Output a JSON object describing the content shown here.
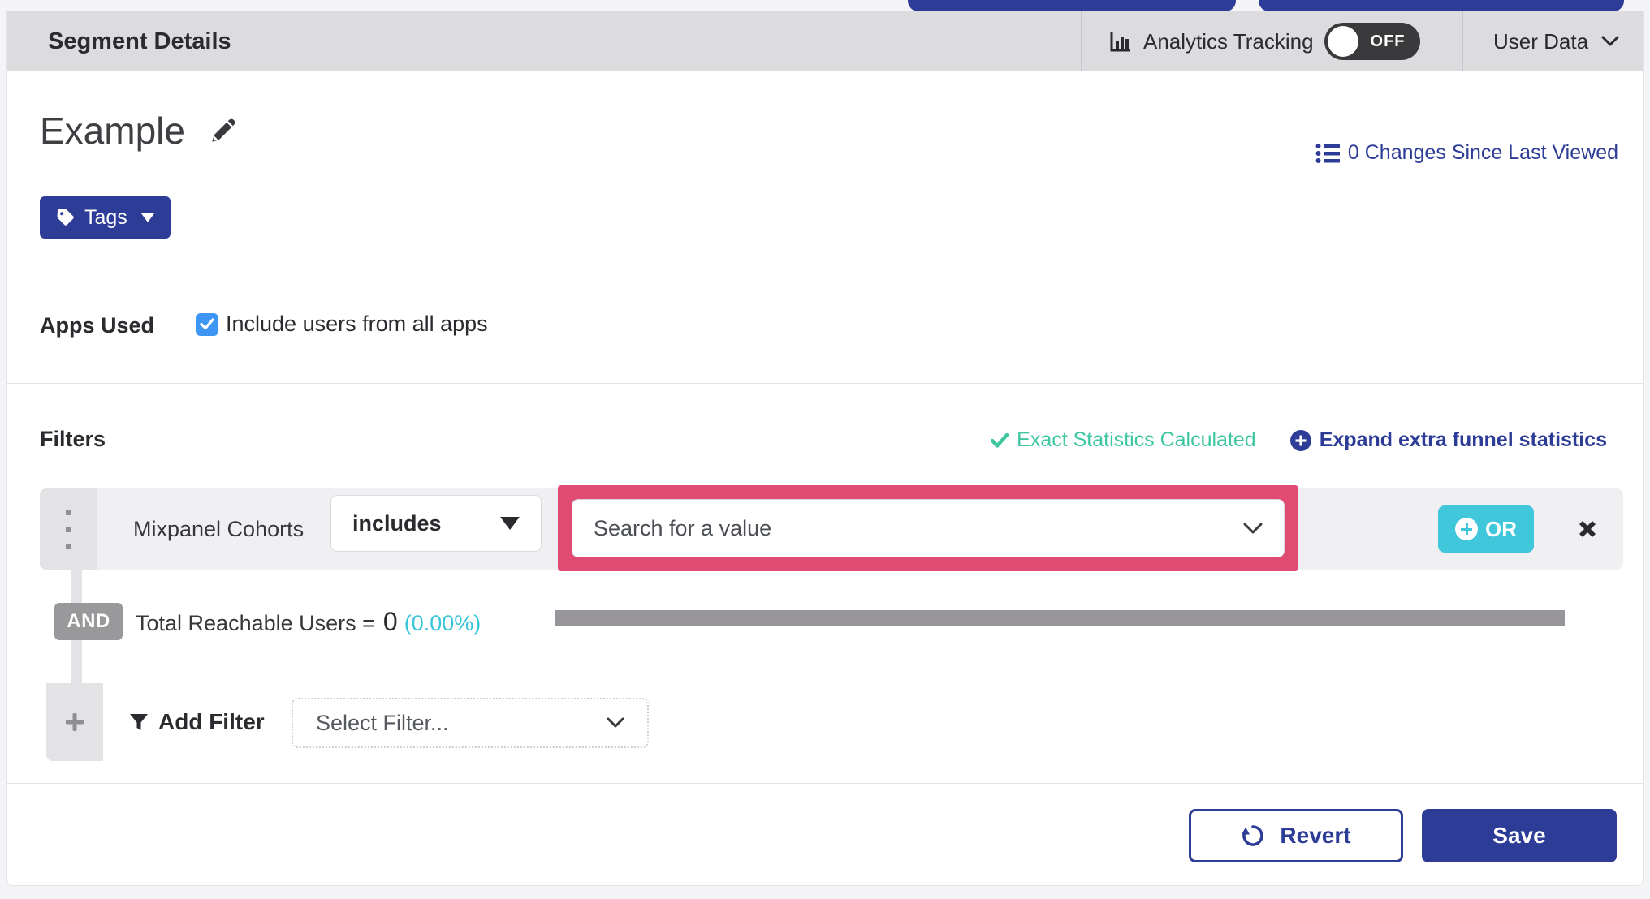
{
  "header": {
    "title": "Segment Details",
    "analytics_label": "Analytics Tracking",
    "toggle_state": "OFF",
    "user_data_label": "User Data"
  },
  "segment": {
    "name": "Example",
    "tags_label": "Tags",
    "changes_link": "0 Changes Since Last Viewed"
  },
  "apps": {
    "label": "Apps Used",
    "checkbox_label": "Include users from all apps",
    "checkbox_checked": true
  },
  "filters": {
    "heading": "Filters",
    "exact_stats": "Exact Statistics Calculated",
    "expand_link": "Expand extra funnel statistics",
    "row": {
      "name": "Mixpanel Cohorts",
      "operator": "includes",
      "value_placeholder": "Search for a value",
      "or_label": "OR"
    },
    "and_label": "AND",
    "total": {
      "label": "Total Reachable Users =",
      "value": "0",
      "percent": "(0.00%)",
      "bar_fill_percent": 0
    },
    "add": {
      "label": "Add Filter",
      "placeholder": "Select Filter..."
    }
  },
  "footer": {
    "revert_label": "Revert",
    "save_label": "Save"
  },
  "colors": {
    "indigo": "#2d3c96",
    "success_teal": "#3fc7a2",
    "stat_cyan": "#38c5d8",
    "or_button_cyan": "#41c7dc",
    "highlight_pink": "#e14b72",
    "checkbox_blue": "#3e96f4",
    "header_gray": "#dcdcdf",
    "bar_gray": "#98969b"
  }
}
